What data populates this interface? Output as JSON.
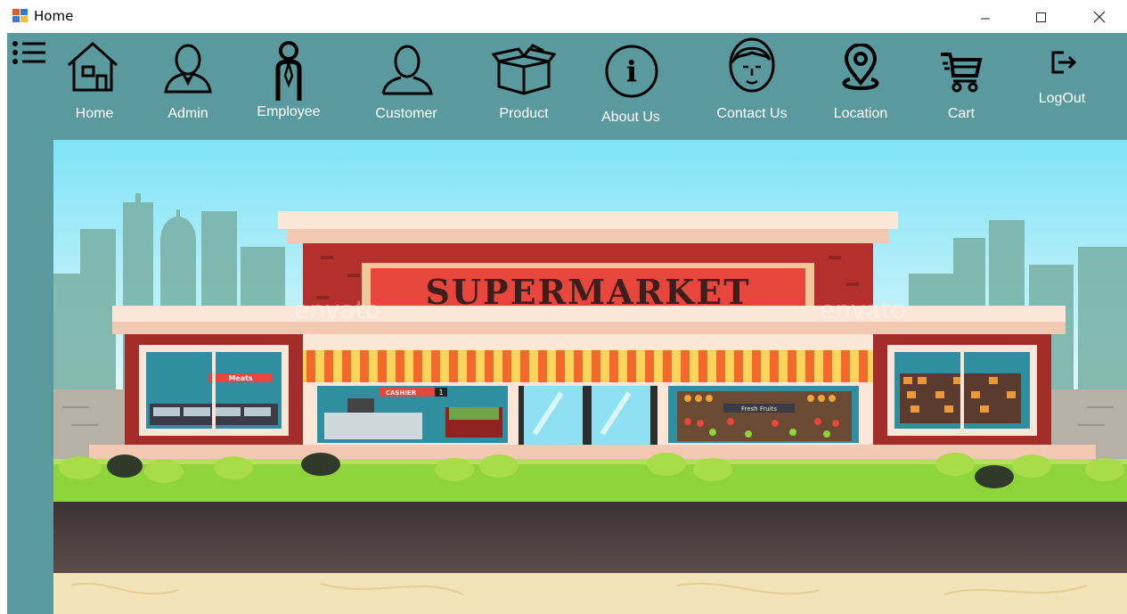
{
  "window": {
    "title": "Home"
  },
  "nav": {
    "items": [
      {
        "id": "home",
        "label": "Home",
        "icon": "house-icon"
      },
      {
        "id": "admin",
        "label": "Admin",
        "icon": "admin-user-icon"
      },
      {
        "id": "employee",
        "label": "Employee",
        "icon": "employee-icon"
      },
      {
        "id": "customer",
        "label": "Customer",
        "icon": "customer-icon"
      },
      {
        "id": "product",
        "label": "Product",
        "icon": "box-icon"
      },
      {
        "id": "about",
        "label": "About Us",
        "icon": "info-icon"
      },
      {
        "id": "contact",
        "label": "Contact Us",
        "icon": "face-icon"
      },
      {
        "id": "location",
        "label": "Location",
        "icon": "map-pin-icon"
      },
      {
        "id": "cart",
        "label": "Cart",
        "icon": "cart-icon"
      },
      {
        "id": "logout",
        "label": "LogOut",
        "icon": "logout-icon"
      }
    ]
  },
  "banner": {
    "store_sign": "SUPERMARKET",
    "meats_sign": "Meats",
    "cashier_sign": "CASHIER",
    "cashier_number": "1",
    "fresh_fruits_sign": "Fresh Fruits",
    "watermark": "envato"
  },
  "colors": {
    "panel": "#5a9a9e",
    "sky": "#8fe0f2",
    "brick": "#b3302c",
    "sign_red": "#e8453c",
    "grass": "#8fd43a",
    "road": "#4a3f3f"
  }
}
